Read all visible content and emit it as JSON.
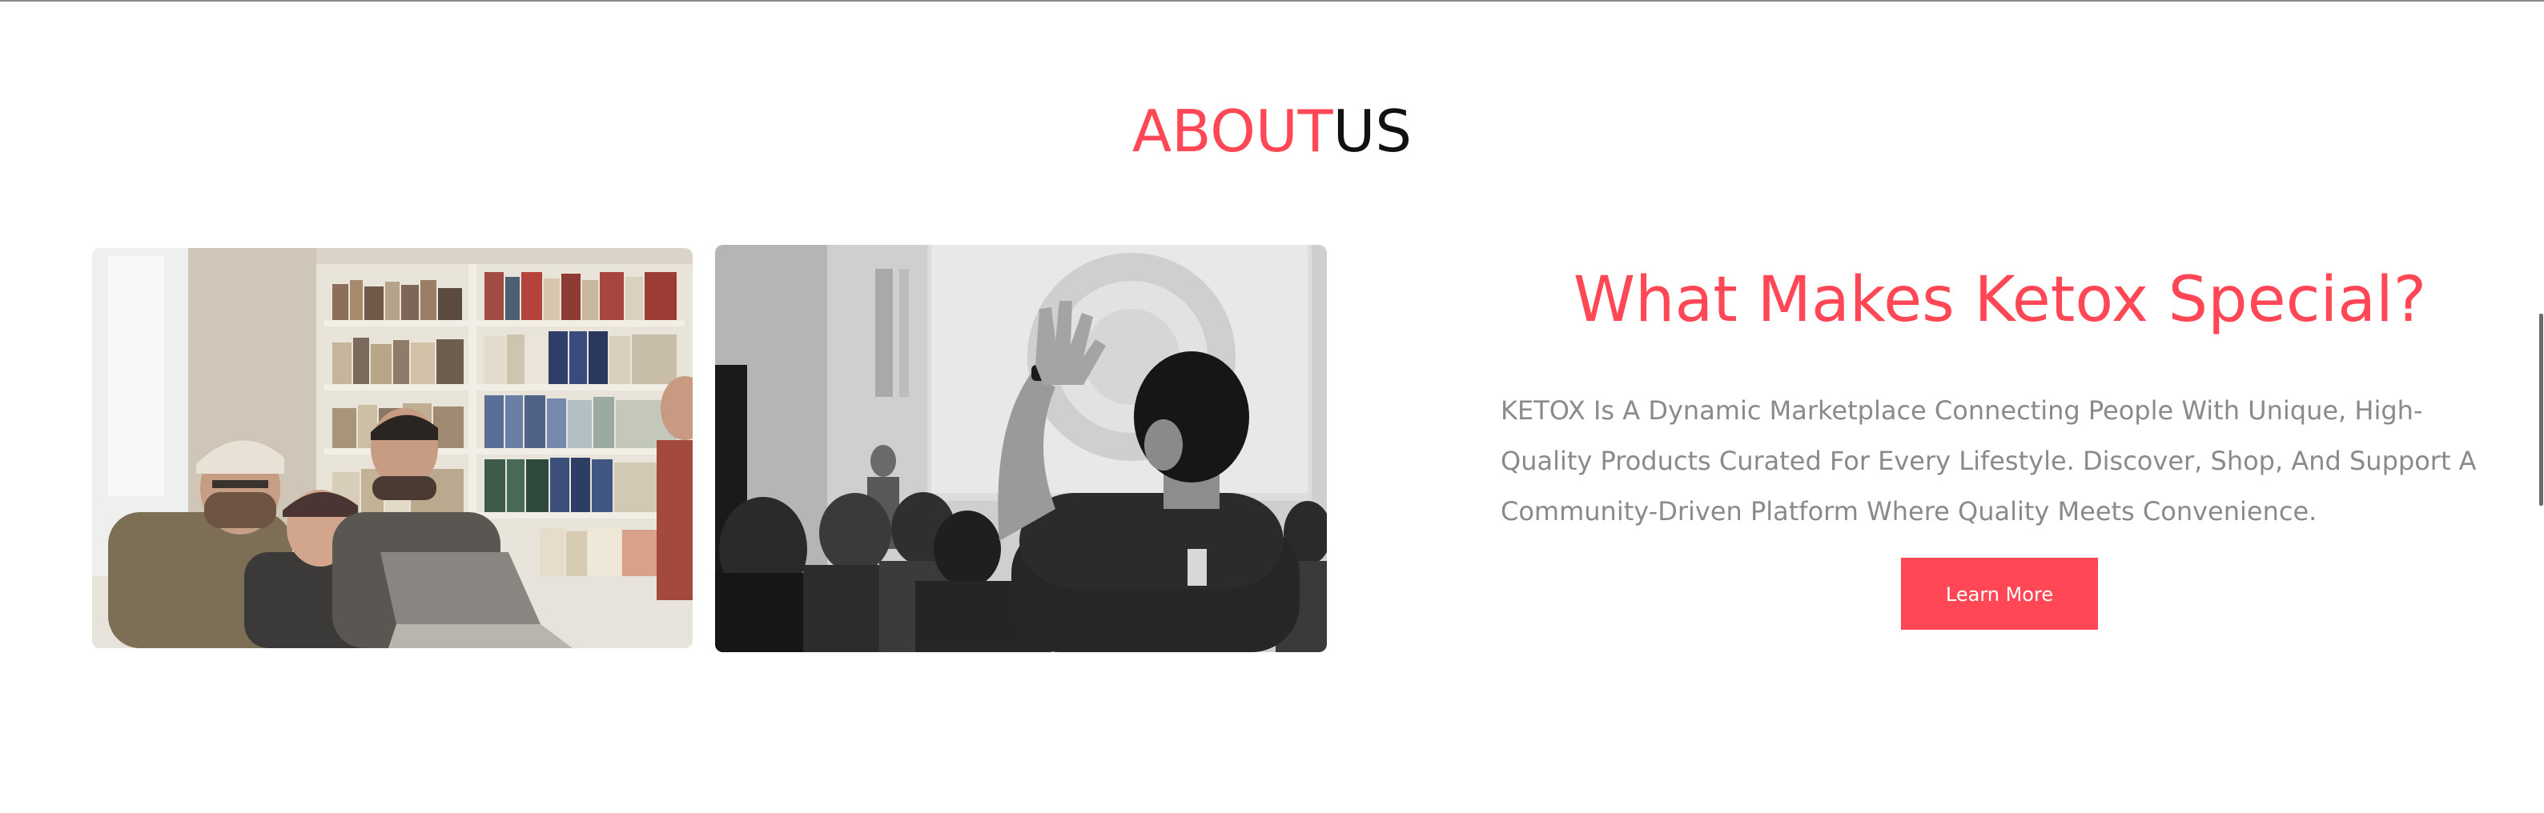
{
  "section": {
    "title_accent": "ABOUT",
    "title_rest": "US"
  },
  "about": {
    "heading": "What Makes Ketox Special?",
    "description": "KETOX Is A Dynamic Marketplace Connecting People With Unique, High-Quality Products Curated For Every Lifestyle. Discover, Shop, And Support A Community-Driven Platform Where Quality Meets Convenience.",
    "button_label": "Learn More"
  },
  "colors": {
    "accent": "#ff4756",
    "title_dark": "#111111",
    "body_text": "#8a8a8a",
    "button_text": "#ffffff"
  },
  "images": [
    {
      "name": "team-library-photo",
      "tone": "color"
    },
    {
      "name": "audience-raised-hand-photo",
      "tone": "grayscale"
    }
  ]
}
